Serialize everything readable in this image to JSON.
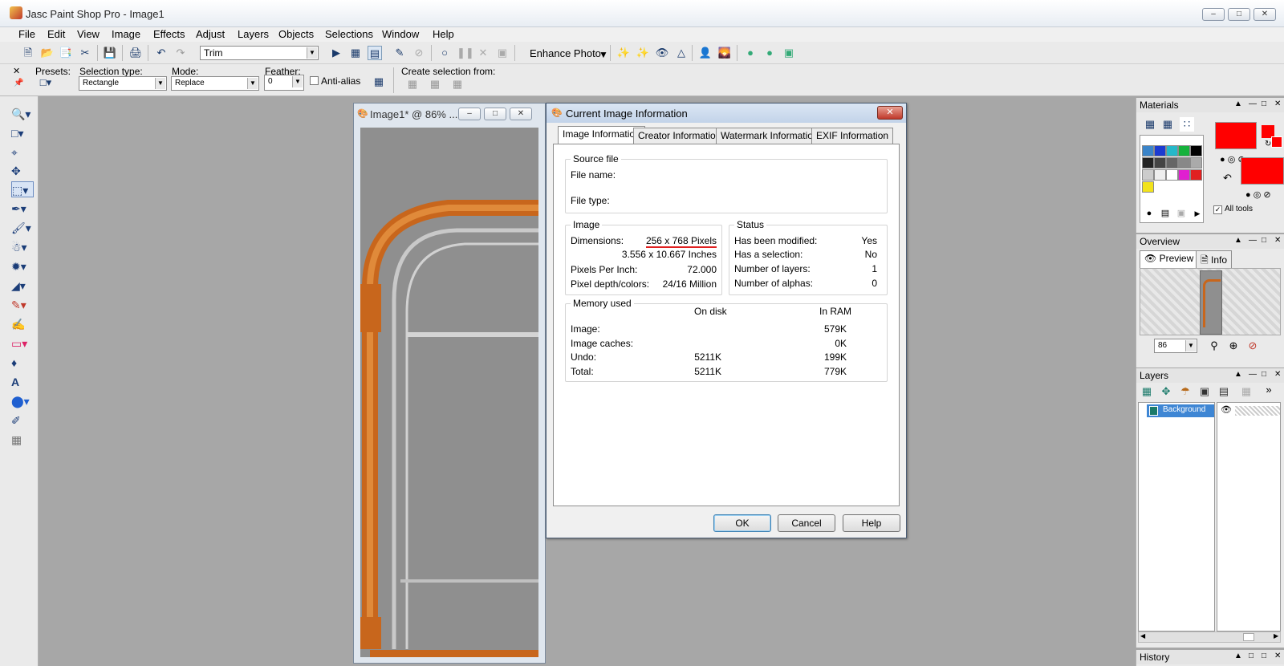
{
  "app": {
    "title": "Jasc Paint Shop Pro - Image1"
  },
  "menu": [
    "File",
    "Edit",
    "View",
    "Image",
    "Effects",
    "Adjust",
    "Layers",
    "Objects",
    "Selections",
    "Window",
    "Help"
  ],
  "toolbar": {
    "script_combo": "Trim",
    "enhance_photo": "Enhance Photo"
  },
  "tool_options": {
    "presets_label": "Presets:",
    "selection_type_label": "Selection type:",
    "selection_type_value": "Rectangle",
    "mode_label": "Mode:",
    "mode_value": "Replace",
    "feather_label": "Feather:",
    "feather_value": "0",
    "antialias_label": "Anti-alias",
    "create_from_label": "Create selection from:"
  },
  "image_window": {
    "title": "Image1* @  86% ..."
  },
  "dialog": {
    "title": "Current Image Information",
    "tabs": [
      "Image Information",
      "Creator Information",
      "Watermark Information",
      "EXIF Information"
    ],
    "source_file": {
      "label": "Source file",
      "file_name_label": "File name:",
      "file_type_label": "File type:"
    },
    "image": {
      "label": "Image",
      "dimensions_label": "Dimensions:",
      "dimensions_px": "256 x 768 Pixels",
      "dimensions_in": "3.556 x 10.667 Inches",
      "ppi_label": "Pixels Per Inch:",
      "ppi_value": "72.000",
      "depth_label": "Pixel depth/colors:",
      "depth_value": "24/16 Million"
    },
    "status": {
      "label": "Status",
      "rows": [
        {
          "label": "Has been modified:",
          "value": "Yes"
        },
        {
          "label": "Has a selection:",
          "value": "No"
        },
        {
          "label": "Number of layers:",
          "value": "1"
        },
        {
          "label": "Number of alphas:",
          "value": "0"
        }
      ]
    },
    "memory": {
      "label": "Memory used",
      "col_disk": "On disk",
      "col_ram": "In RAM",
      "rows": [
        {
          "label": "Image:",
          "disk": "",
          "ram": "579K"
        },
        {
          "label": "Image caches:",
          "disk": "",
          "ram": "0K"
        },
        {
          "label": "Undo:",
          "disk": "5211K",
          "ram": "199K"
        },
        {
          "label": "Total:",
          "disk": "5211K",
          "ram": "779K"
        }
      ]
    },
    "buttons": {
      "ok": "OK",
      "cancel": "Cancel",
      "help": "Help"
    }
  },
  "panels": {
    "materials": {
      "title": "Materials",
      "all_tools": "All tools",
      "primary_color": "#ff0000",
      "secondary_color": "#ff0000"
    },
    "overview": {
      "title": "Overview",
      "tab_preview": "Preview",
      "tab_info": "Info",
      "zoom": "86"
    },
    "layers": {
      "title": "Layers",
      "layer_name": "Background"
    },
    "history": {
      "title": "History"
    }
  }
}
